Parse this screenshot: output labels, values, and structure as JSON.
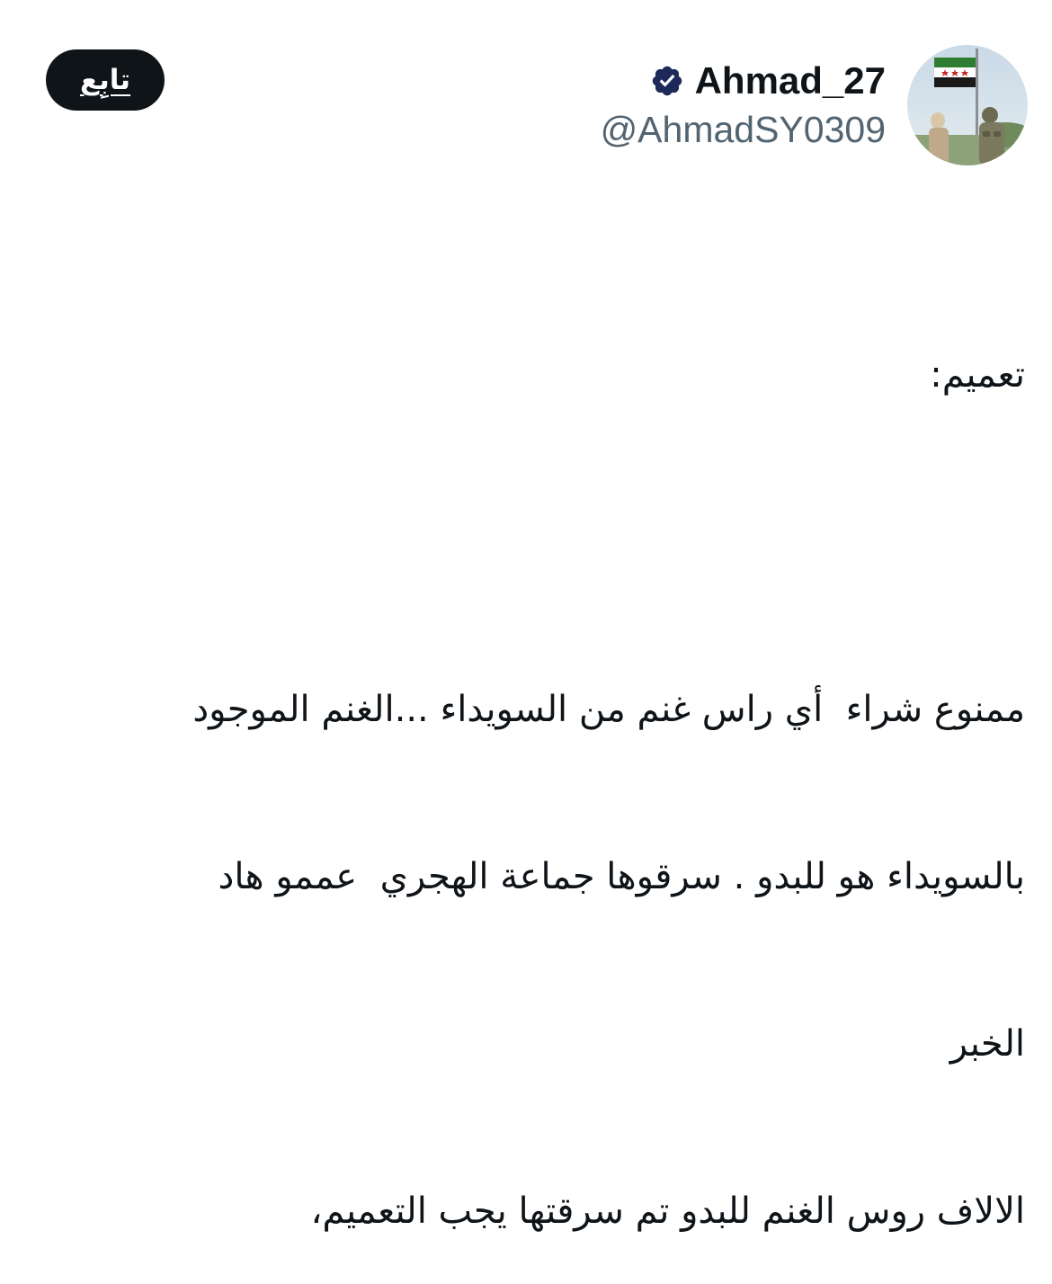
{
  "header": {
    "follow_label": "تابِع",
    "display_name": "Ahmad_27",
    "handle": "@AhmadSY0309",
    "verified": true,
    "verified_color": "#1d2a59"
  },
  "avatar": {
    "icon": "profile-photo-flag-soldier"
  },
  "tweet": {
    "lines": [
      "تعميم:",
      "",
      "ممنوع شراء  أي راس غنم من السويداء ...الغنم الموجود",
      "بالسويداء هو للبدو . سرقوها جماعة الهجري  عممو هاد",
      "الخبر",
      "الالاف روس الغنم للبدو تم سرقتها يجب التعميم،"
    ]
  },
  "colors": {
    "text_primary": "#0f1419",
    "text_secondary": "#536471",
    "button_bg": "#0f1419",
    "button_text": "#ffffff",
    "background": "#ffffff"
  }
}
